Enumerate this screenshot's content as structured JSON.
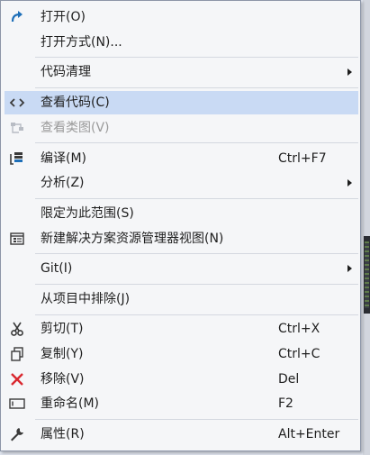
{
  "menu": {
    "items": [
      {
        "label": "打开(O)"
      },
      {
        "label": "打开方式(N)..."
      },
      {
        "label": "代码清理"
      },
      {
        "label": "查看代码(C)"
      },
      {
        "label": "查看类图(V)"
      },
      {
        "label": "编译(M)",
        "shortcut": "Ctrl+F7"
      },
      {
        "label": "分析(Z)"
      },
      {
        "label": "限定为此范围(S)"
      },
      {
        "label": "新建解决方案资源管理器视图(N)"
      },
      {
        "label": "Git(I)"
      },
      {
        "label": "从项目中排除(J)"
      },
      {
        "label": "剪切(T)",
        "shortcut": "Ctrl+X"
      },
      {
        "label": "复制(Y)",
        "shortcut": "Ctrl+C"
      },
      {
        "label": "移除(V)",
        "shortcut": "Del"
      },
      {
        "label": "重命名(M)",
        "shortcut": "F2"
      },
      {
        "label": "属性(R)",
        "shortcut": "Alt+Enter"
      }
    ]
  },
  "colors": {
    "selected_bg": "#c9daf4",
    "remove_icon": "#d9272e",
    "accent": "#1e6fb8"
  }
}
